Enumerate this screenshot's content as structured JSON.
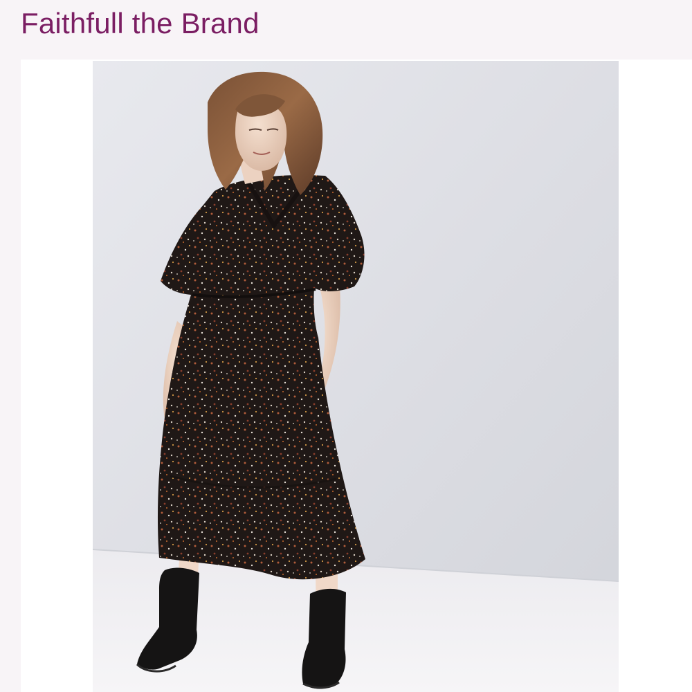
{
  "header": {
    "brand_name": "Faithfull the Brand",
    "accent_color": "#7b1e63"
  },
  "product_image": {
    "icon": "product-photo-icon"
  }
}
